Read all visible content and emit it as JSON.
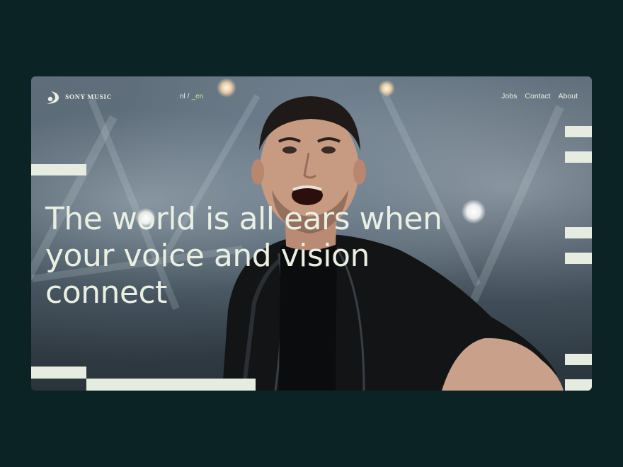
{
  "brand": {
    "logo_text": "SONY MUSIC",
    "icon": "sony-music-swoosh-icon"
  },
  "language": {
    "options": [
      "nl",
      "_en"
    ],
    "separator": "/",
    "active": "_en"
  },
  "nav": {
    "items": [
      "Jobs",
      "Contact",
      "About"
    ]
  },
  "hero": {
    "headline": "The world is all ears when your voice and vision connect"
  },
  "colors": {
    "page_background": "#0b2324",
    "text": "#e9efe2",
    "accent": "#cfe389",
    "bars": "#e6ede0"
  }
}
